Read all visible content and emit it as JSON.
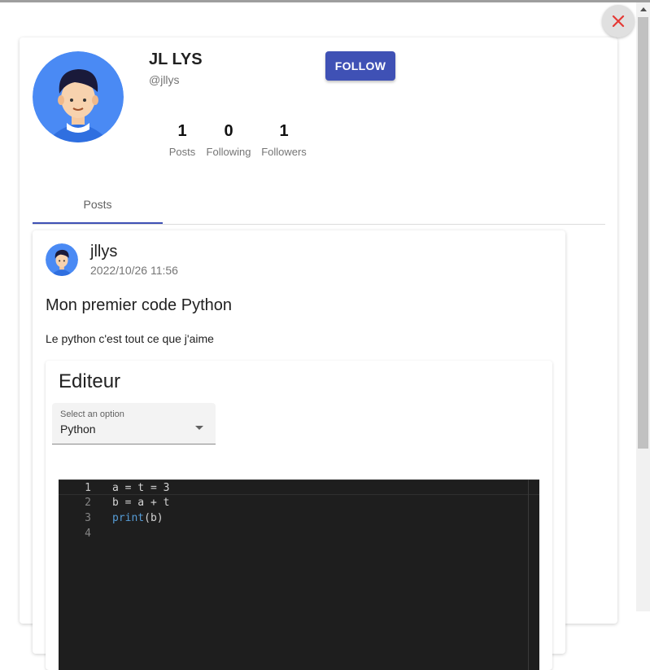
{
  "profile": {
    "name": "JL LYS",
    "handle": "@jllys",
    "follow_label": "FOLLOW",
    "stats": [
      {
        "value": "1",
        "label": "Posts"
      },
      {
        "value": "0",
        "label": "Following"
      },
      {
        "value": "1",
        "label": "Followers"
      }
    ]
  },
  "tabs": [
    {
      "label": "Posts"
    }
  ],
  "post": {
    "author": "jllys",
    "date": "2022/10/26 11:56",
    "title": "Mon premier code Python",
    "body": "Le python c'est tout ce que j'aime",
    "editor": {
      "title": "Editeur",
      "select_label": "Select an option",
      "select_value": "Python",
      "lines": [
        {
          "n": "1",
          "text": "a = t = 3"
        },
        {
          "n": "2",
          "text": "b = a + t"
        },
        {
          "n": "3",
          "kw": "print",
          "rest": "(b)"
        },
        {
          "n": "4",
          "text": ""
        }
      ]
    }
  },
  "icons": {
    "close": "close-icon",
    "dropdown": "chevron-down-icon",
    "scroll_up": "chevron-up-icon"
  },
  "colors": {
    "primary": "#3f51b5",
    "close": "#e53935",
    "avatar_bg": "#4a8af4"
  }
}
